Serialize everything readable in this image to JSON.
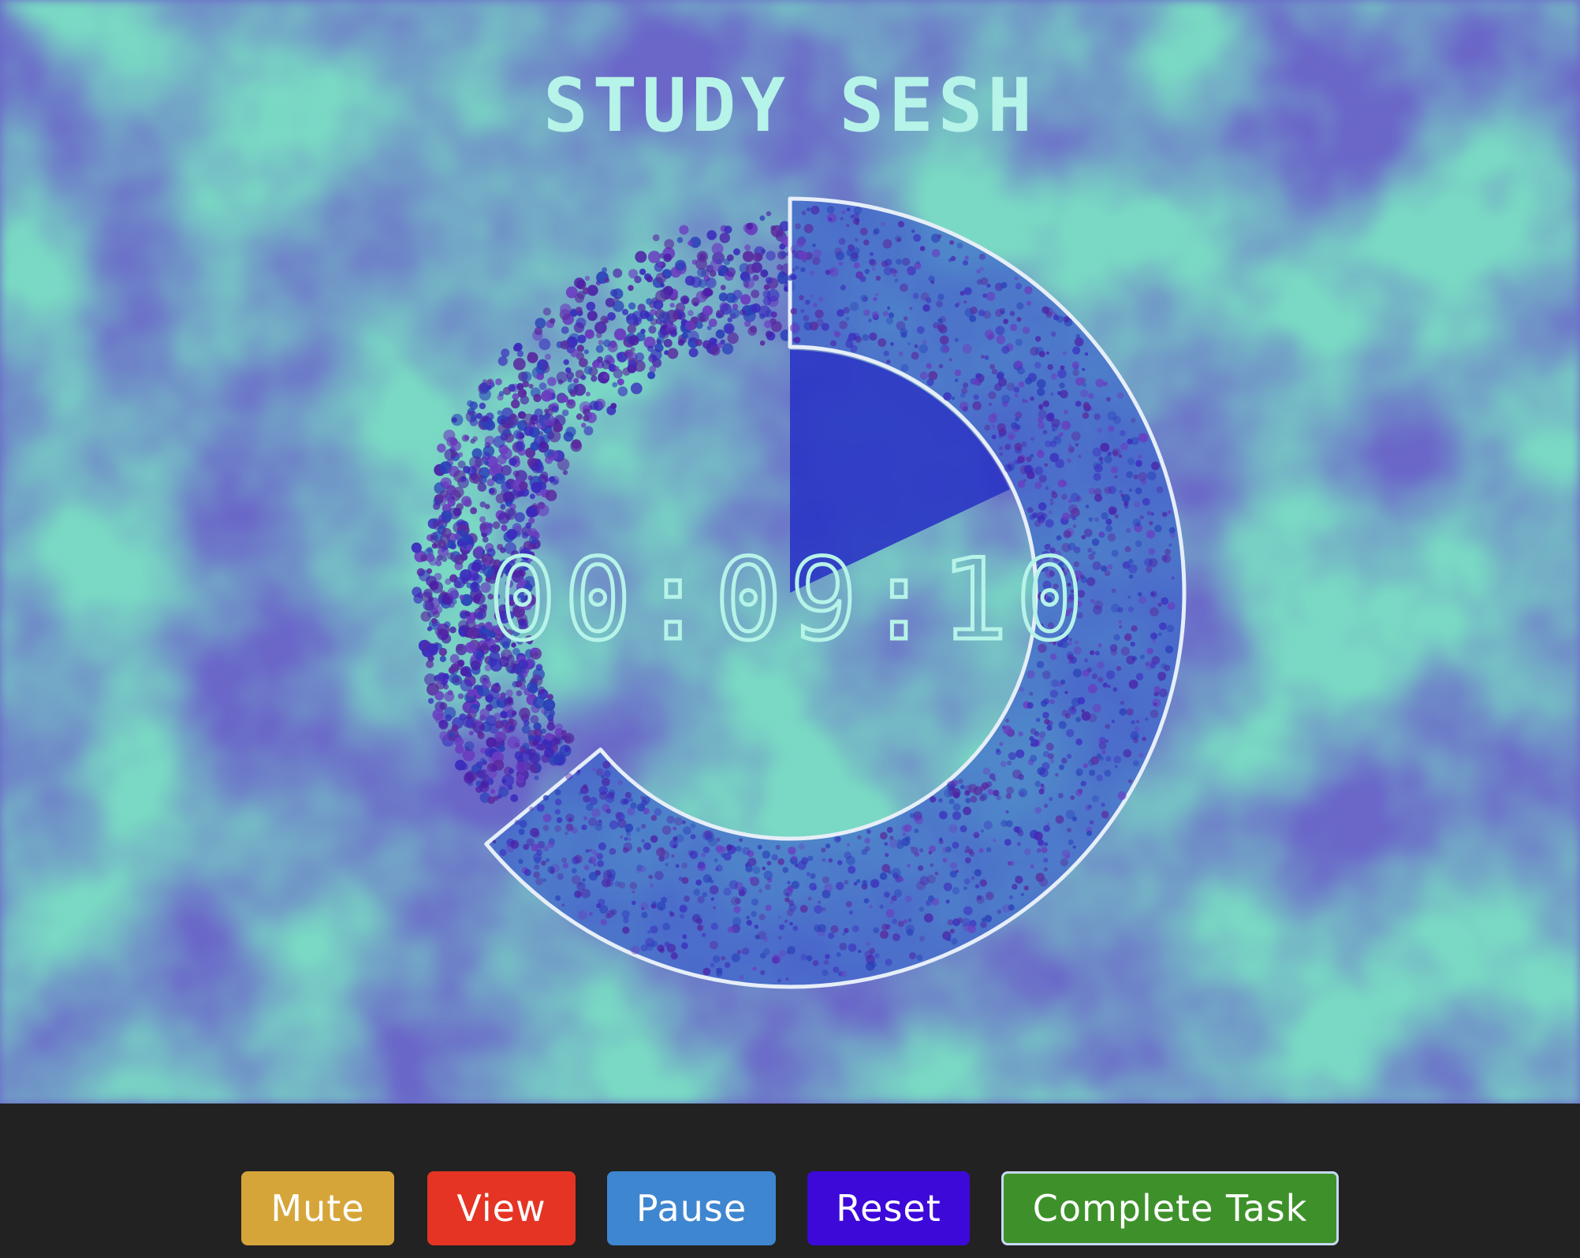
{
  "app": {
    "title": "STUDY SESH",
    "timer": "00:09:10"
  },
  "progress": {
    "remaining_fraction": 0.64,
    "seconds_dial_fraction": 0.18
  },
  "colors": {
    "title": "#b6f3e8",
    "timer": "#b6f3e8",
    "ring_fill": "#3f67cc",
    "ring_outline": "#e6eef8",
    "wedge": "#2a35c4",
    "particles": [
      "#3a2bbd",
      "#4b1fa6",
      "#5a2a9e",
      "#2a3fb8",
      "#6a3cc0"
    ],
    "background_teal": "#79d9c4",
    "background_violet": "#6a67c9"
  },
  "controls": {
    "mute": {
      "label": "Mute",
      "color": "#d6a53a"
    },
    "view": {
      "label": "View",
      "color": "#e53424"
    },
    "pause": {
      "label": "Pause",
      "color": "#3e86d0"
    },
    "reset": {
      "label": "Reset",
      "color": "#3d09d9"
    },
    "complete": {
      "label": "Complete Task",
      "color": "#3e912a"
    }
  }
}
